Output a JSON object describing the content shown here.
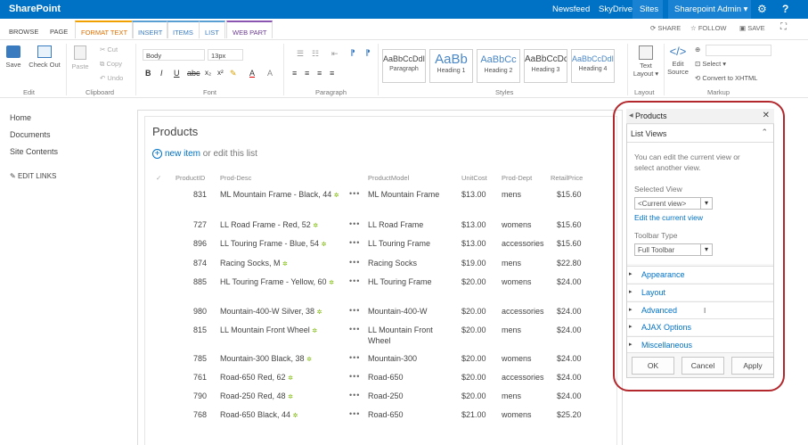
{
  "suitebar": {
    "brand": "SharePoint",
    "links": [
      "Newsfeed",
      "SkyDrive",
      "Sites"
    ],
    "user": "Sharepoint Admin ▾",
    "icons": [
      "gear-icon",
      "help-icon"
    ]
  },
  "tabs": [
    "BROWSE",
    "PAGE",
    "FORMAT TEXT",
    "INSERT",
    "ITEMS",
    "LIST",
    "WEB PART"
  ],
  "actions": {
    "share": "SHARE",
    "follow": "FOLLOW",
    "save": "SAVE"
  },
  "ribbon": {
    "edit": {
      "save": "Save",
      "checkout": "Check Out",
      "label": "Edit"
    },
    "clipboard": {
      "paste": "Paste",
      "cut": "Cut",
      "copy": "Copy",
      "undo": "Undo",
      "label": "Clipboard"
    },
    "font": {
      "family": "Body",
      "size": "13px",
      "label": "Font"
    },
    "paragraph": {
      "label": "Paragraph"
    },
    "styles": {
      "label": "Styles",
      "items": [
        {
          "preview": "AaBbCcDdI",
          "name": "Paragraph"
        },
        {
          "preview": "AaBb",
          "name": "Heading 1"
        },
        {
          "preview": "AaBbCc",
          "name": "Heading 2"
        },
        {
          "preview": "AaBbCcDc",
          "name": "Heading 3"
        },
        {
          "preview": "AaBbCcDdI",
          "name": "Heading 4"
        }
      ]
    },
    "layout": {
      "text_layout": "Text Layout ▾",
      "label": "Layout"
    },
    "markup": {
      "edit_source": "Edit Source",
      "select": "Select ▾",
      "convert": "Convert to XHTML",
      "label": "Markup"
    }
  },
  "leftnav": {
    "items": [
      "Home",
      "Documents",
      "Site Contents"
    ],
    "edit_links": "EDIT LINKS"
  },
  "list": {
    "title": "Products",
    "new_item": "new item",
    "new_item_rest": " or edit this list",
    "columns": [
      "ProductID",
      "Prod-Desc",
      "ProductModel",
      "UnitCost",
      "Prod-Dept",
      "RetailPrice"
    ],
    "rows": [
      {
        "id": "831",
        "desc": "ML Mountain Frame - Black, 44",
        "model": "ML Mountain Frame",
        "cost": "$13.00",
        "dept": "mens",
        "price": "$15.60"
      },
      {
        "id": "727",
        "desc": "LL Road Frame - Red, 52",
        "model": "LL Road Frame",
        "cost": "$13.00",
        "dept": "womens",
        "price": "$15.60"
      },
      {
        "id": "896",
        "desc": "LL Touring Frame - Blue, 54",
        "model": "LL Touring Frame",
        "cost": "$13.00",
        "dept": "accessories",
        "price": "$15.60"
      },
      {
        "id": "874",
        "desc": "Racing Socks, M",
        "model": "Racing Socks",
        "cost": "$19.00",
        "dept": "mens",
        "price": "$22.80"
      },
      {
        "id": "885",
        "desc": "HL Touring Frame - Yellow, 60",
        "model": "HL Touring Frame",
        "cost": "$20.00",
        "dept": "womens",
        "price": "$24.00"
      },
      {
        "id": "980",
        "desc": "Mountain-400-W Silver, 38",
        "model": "Mountain-400-W",
        "cost": "$20.00",
        "dept": "accessories",
        "price": "$24.00"
      },
      {
        "id": "815",
        "desc": "LL Mountain Front Wheel",
        "model": "LL Mountain Front Wheel",
        "cost": "$20.00",
        "dept": "mens",
        "price": "$24.00"
      },
      {
        "id": "785",
        "desc": "Mountain-300 Black, 38",
        "model": "Mountain-300",
        "cost": "$20.00",
        "dept": "womens",
        "price": "$24.00"
      },
      {
        "id": "761",
        "desc": "Road-650 Red, 62",
        "model": "Road-650",
        "cost": "$20.00",
        "dept": "accessories",
        "price": "$24.00"
      },
      {
        "id": "790",
        "desc": "Road-250 Red, 48",
        "model": "Road-250",
        "cost": "$20.00",
        "dept": "mens",
        "price": "$24.00"
      },
      {
        "id": "768",
        "desc": "Road-650 Black, 44",
        "model": "Road-650",
        "cost": "$21.00",
        "dept": "womens",
        "price": "$25.20"
      }
    ]
  },
  "toolpane": {
    "title": "Products",
    "section": "List Views",
    "description": "You can edit the current view or select another view.",
    "selected_view_label": "Selected View",
    "selected_view": "<Current view>",
    "edit_link": "Edit the current view",
    "toolbar_type_label": "Toolbar Type",
    "toolbar_type": "Full Toolbar",
    "sections": [
      "Appearance",
      "Layout",
      "Advanced",
      "AJAX Options",
      "Miscellaneous"
    ],
    "buttons": {
      "ok": "OK",
      "cancel": "Cancel",
      "apply": "Apply"
    }
  },
  "colors": {
    "suitebar": "#0072c6",
    "highlight_ring": "#b3282d",
    "format_tab": "#f0a000",
    "web_part_tab": "#8a55b0"
  }
}
